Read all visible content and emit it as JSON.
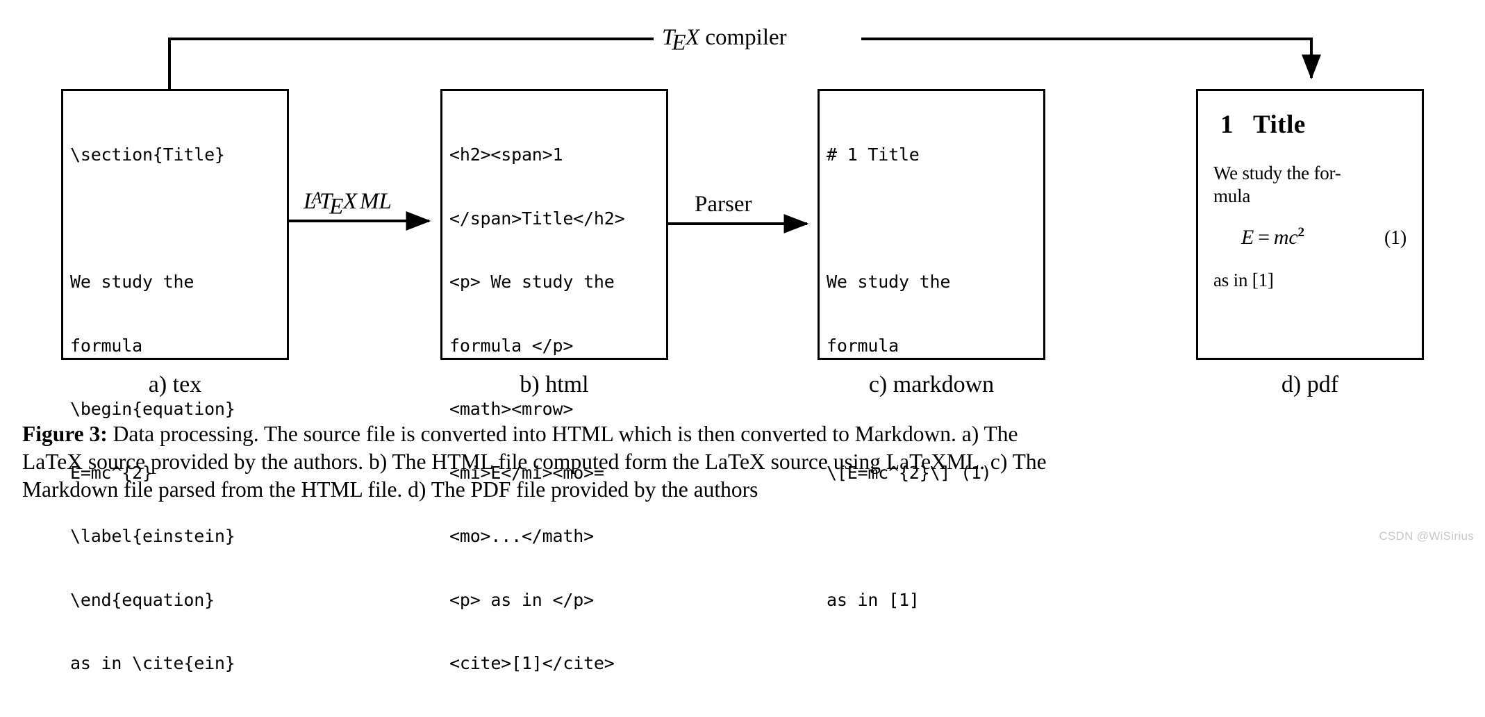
{
  "figure": {
    "top_arrow_label": {
      "logo": "TeX",
      "text": "compiler",
      "full": "TEX compiler"
    },
    "arrows": [
      {
        "name": "latexml",
        "label": "LaTeXML"
      },
      {
        "name": "parser",
        "label": "Parser"
      }
    ],
    "boxes": [
      {
        "id": "tex",
        "caption": "a) tex",
        "lines": [
          "\\section{Title}",
          "",
          "We study the",
          "formula",
          "\\begin{equation}",
          "E=mc^{2}",
          "\\label{einstein}",
          "\\end{equation}",
          "as in \\cite{ein}"
        ]
      },
      {
        "id": "html",
        "caption": "b) html",
        "lines": [
          "<h2><span>1",
          "</span>Title</h2>",
          "<p> We study the",
          "formula </p>",
          "<math><mrow>",
          "<mi>E</mi><mo>=",
          "<mo>...</math>",
          "<p> as in </p>",
          "<cite>[1]</cite>"
        ]
      },
      {
        "id": "markdown",
        "caption": "c) markdown",
        "lines": [
          "# 1 Title",
          "",
          "We study the",
          "formula",
          "",
          "\\[E=mc^{2}\\] (1)",
          "",
          "as in [1]"
        ]
      },
      {
        "id": "pdf",
        "caption": "d) pdf",
        "heading_number": "1",
        "heading_text": "Title",
        "paragraph": "We study the for-mula",
        "equation": "E = mc2",
        "equation_parts": {
          "lhs": "E",
          "op": "=",
          "rhs": "mc",
          "exponent": "2"
        },
        "equation_number": "(1)",
        "tail": "as in [1]"
      }
    ]
  },
  "caption": {
    "label": "Figure 3:",
    "lines": [
      "Data processing. The source file is converted into HTML which is then converted to Markdown. a) The",
      "LaTeX source provided by the authors. b) The HTML file computed form the LaTeX source using LaTeXML. c) The",
      "Markdown file parsed from the HTML file. d) The PDF file provided by the authors"
    ],
    "full_text": "Figure 3: Data processing. The source file is converted into HTML which is then converted to Markdown. a) The LaTeX source provided by the authors. b) The HTML file computed form the LaTeX source using LaTeXML. c) The Markdown file parsed from the HTML file. d) The PDF file provided by the authors"
  },
  "watermark": "CSDN @WiSirius",
  "colors": {
    "stroke": "#000000",
    "background": "#ffffff",
    "watermark": "#c8c8c8"
  }
}
